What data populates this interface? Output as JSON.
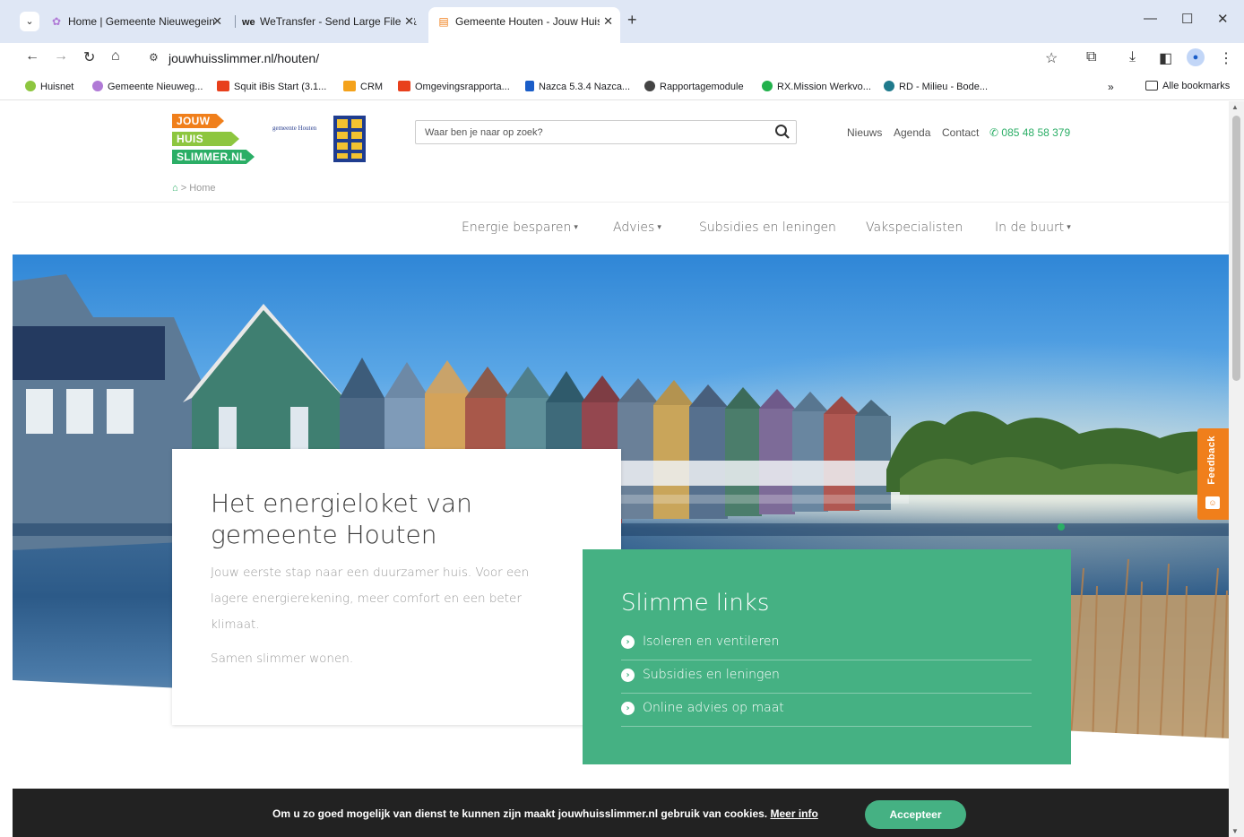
{
  "browser": {
    "tabs": [
      {
        "title": "Home | Gemeente Nieuwegein",
        "favicon": "gemeente-icon",
        "active": false
      },
      {
        "title": "WeTransfer - Send Large Files &",
        "favicon": "wetransfer-icon",
        "active": false
      },
      {
        "title": "Gemeente Houten - Jouw Huis",
        "favicon": "jouwhuis-icon",
        "active": true
      }
    ],
    "new_tab": "+",
    "url": "jouwhuisslimmer.nl/houten/",
    "bookmarks": [
      {
        "label": "Huisnet",
        "color": "#8dc63f"
      },
      {
        "label": "Gemeente Nieuweg...",
        "color": "#b07ad6"
      },
      {
        "label": "Squit iBis Start (3.1...",
        "color": "#e8401c"
      },
      {
        "label": "CRM",
        "color": "#f4a21b"
      },
      {
        "label": "Omgevingsrapporta...",
        "color": "#e8401c"
      },
      {
        "label": "Nazca 5.3.4 Nazca...",
        "color": "#1a5dc8"
      },
      {
        "label": "Rapportagemodule",
        "color": "#444444"
      },
      {
        "label": "RX.Mission Werkvo...",
        "color": "#22b14c"
      },
      {
        "label": "RD - Milieu - Bode...",
        "color": "#1f7a8c"
      }
    ],
    "bookmarks_overflow": "»",
    "all_bookmarks": "Alle bookmarks"
  },
  "site": {
    "logo": {
      "line1": "JOUW",
      "line2": "HUIS",
      "line3": "SLIMMER.NL"
    },
    "gemeente_label": "gemeente Houten",
    "search_placeholder": "Waar ben je naar op zoek?",
    "top_links": [
      "Nieuws",
      "Agenda",
      "Contact"
    ],
    "phone": "085 48 58 379",
    "breadcrumb": "> Home",
    "nav": [
      {
        "label": "Energie besparen",
        "dropdown": true
      },
      {
        "label": "Advies",
        "dropdown": true
      },
      {
        "label": "Subsidies en leningen",
        "dropdown": false
      },
      {
        "label": "Vakspecialisten",
        "dropdown": false
      },
      {
        "label": "In de buurt",
        "dropdown": true
      }
    ],
    "caret": "▾",
    "intro": {
      "title": "Het energieloket van gemeente Houten",
      "text": "Jouw eerste stap naar een duurzamer huis. Voor een lagere energierekening, meer comfort en een beter klimaat.",
      "tagline": "Samen slimmer wonen."
    },
    "smart_links": {
      "title": "Slimme links",
      "items": [
        "Isoleren en ventileren",
        "Subsidies en leningen",
        "Online advies op maat"
      ]
    },
    "feedback_label": "Feedback",
    "cookie": {
      "text": "Om u zo goed mogelijk van dienst te kunnen zijn maakt jouwhuisslimmer.nl gebruik van cookies.",
      "more_info": "Meer info",
      "accept": "Accepteer"
    },
    "colors": {
      "green": "#45b183",
      "orange": "#f07f1b",
      "lime": "#8dc63f"
    }
  }
}
